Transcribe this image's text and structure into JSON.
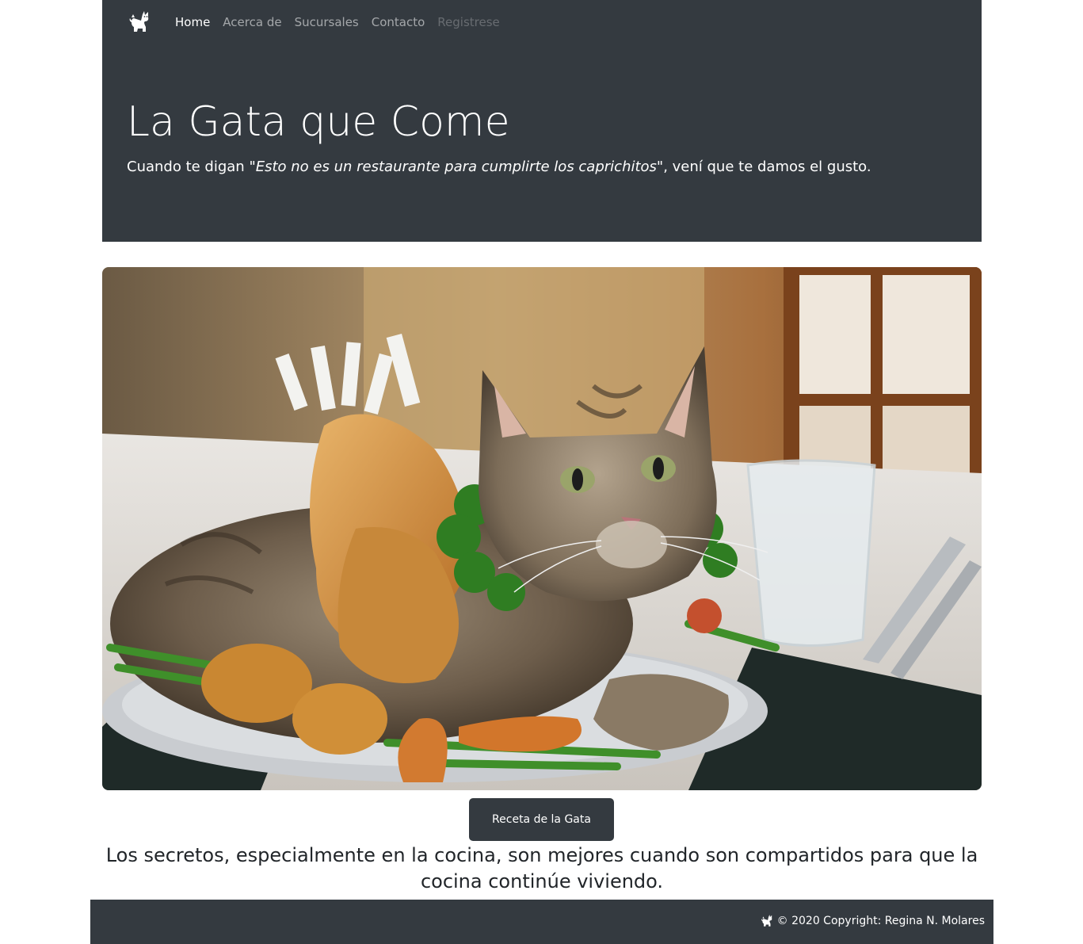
{
  "nav": {
    "brand_icon": "cat-icon",
    "items": [
      {
        "label": "Home",
        "state": "active"
      },
      {
        "label": "Acerca de",
        "state": "normal"
      },
      {
        "label": "Sucursales",
        "state": "normal"
      },
      {
        "label": "Contacto",
        "state": "normal"
      },
      {
        "label": "Registrese",
        "state": "disabled"
      }
    ]
  },
  "hero": {
    "title": "La Gata que Come",
    "lead_prefix": "Cuando te digan ",
    "lead_quote": "\"Esto no es un restaurante para cumplirte los caprichitos\"",
    "lead_suffix": ", vení que te damos el gusto."
  },
  "main": {
    "image_subject": "cat-on-platter-photo",
    "button_label": "Receta de la Gata",
    "secret_text": "Los secretos, especialmente en la cocina, son mejores cuando son compartidos para que la cocina continúe viviendo."
  },
  "footer": {
    "icon": "cat-icon",
    "copyright": "© 2020 Copyright: Regina N. Molares"
  },
  "colors": {
    "dark": "#343a40",
    "white": "#ffffff"
  }
}
